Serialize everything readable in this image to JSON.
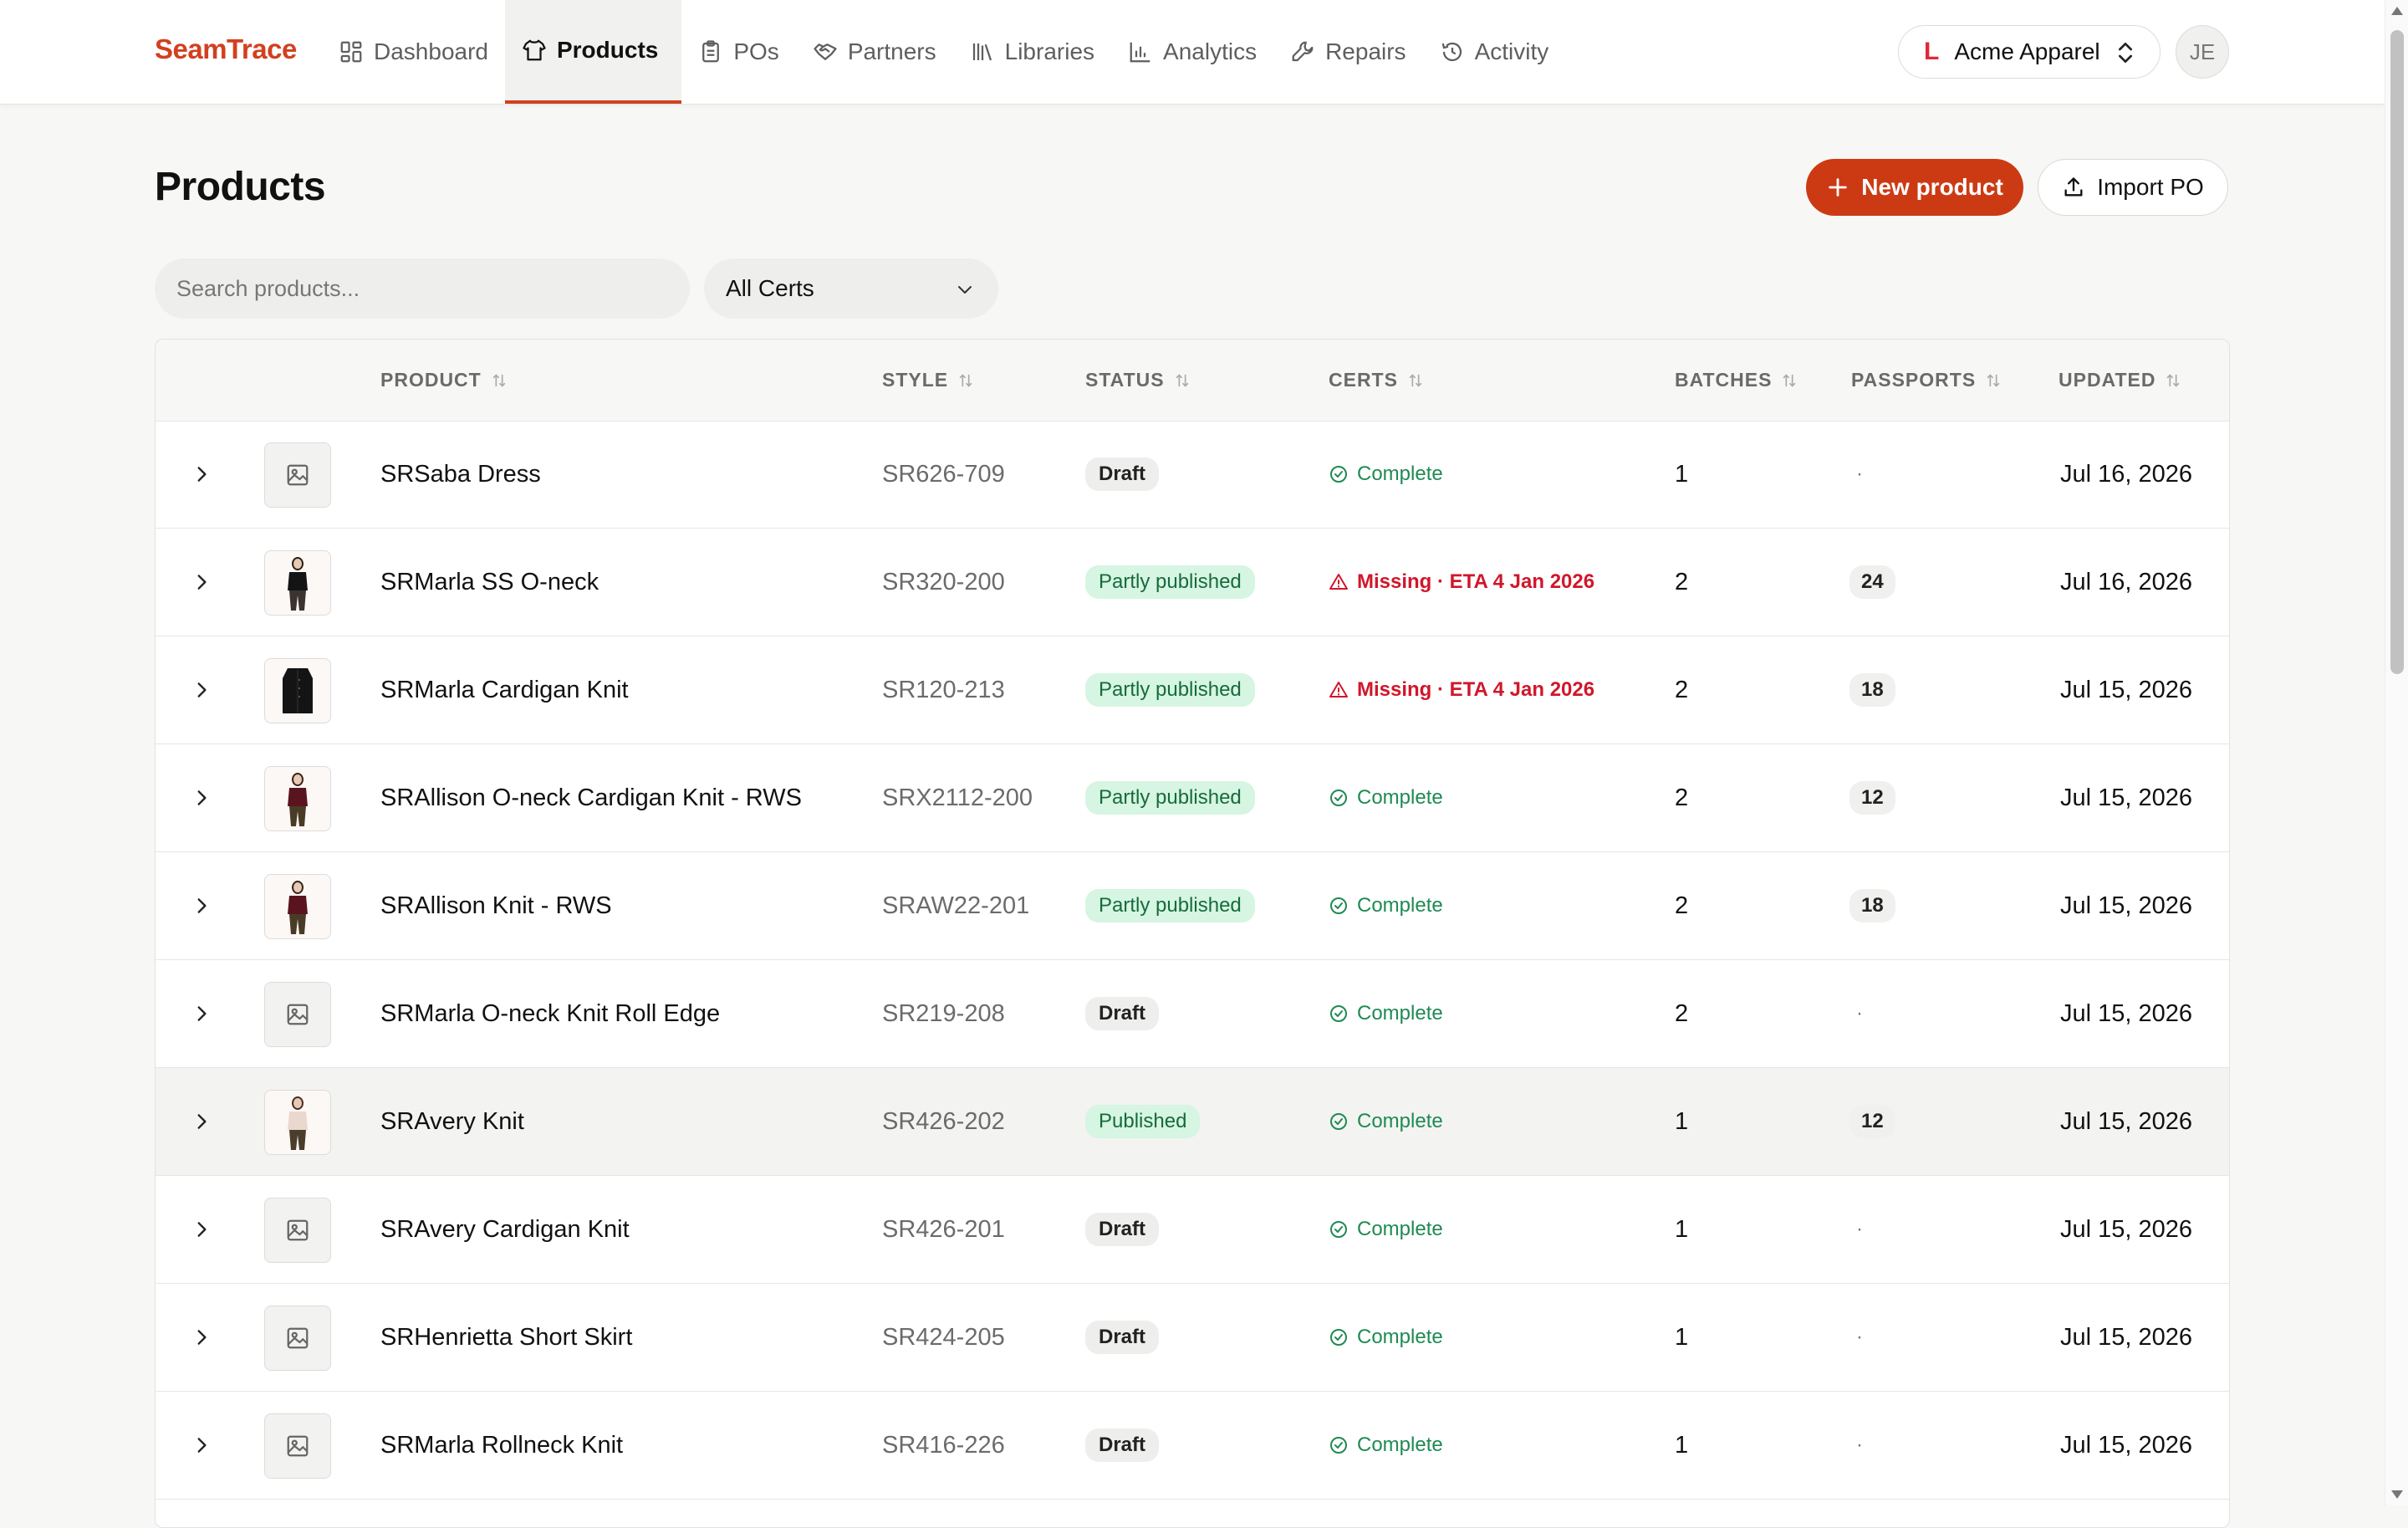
{
  "brand": "SeamTrace",
  "nav": [
    {
      "label": "Dashboard",
      "icon": "dashboard-icon"
    },
    {
      "label": "Products",
      "icon": "shirt-icon",
      "active": true
    },
    {
      "label": "POs",
      "icon": "clipboard-icon"
    },
    {
      "label": "Partners",
      "icon": "handshake-icon"
    },
    {
      "label": "Libraries",
      "icon": "library-icon"
    },
    {
      "label": "Analytics",
      "icon": "bar-chart-icon"
    },
    {
      "label": "Repairs",
      "icon": "wrench-icon"
    },
    {
      "label": "Activity",
      "icon": "history-icon"
    }
  ],
  "org": {
    "logo": "L",
    "name": "Acme Apparel"
  },
  "user": {
    "initials": "JE"
  },
  "page": {
    "title": "Products"
  },
  "actions": {
    "new_product": "New product",
    "import_po": "Import PO"
  },
  "filters": {
    "search_placeholder": "Search products...",
    "certs_value": "All Certs"
  },
  "table": {
    "columns": [
      "PRODUCT",
      "STYLE",
      "STATUS",
      "CERTS",
      "BATCHES",
      "PASSPORTS",
      "UPDATED"
    ],
    "rows": [
      {
        "name": "SRSaba Dress",
        "style": "SR626-709",
        "status": "Draft",
        "status_kind": "draft",
        "certs": "Complete",
        "certs_kind": "ok",
        "batches": "1",
        "passports": "·",
        "updated": "Jul 16, 2026",
        "thumb": "placeholder"
      },
      {
        "name": "SRMarla SS O-neck",
        "style": "SR320-200",
        "status": "Partly published",
        "status_kind": "partly",
        "certs": "Missing · ETA 4 Jan 2026",
        "certs_kind": "missing",
        "batches": "2",
        "passports": "24",
        "updated": "Jul 16, 2026",
        "thumb": "photo-black"
      },
      {
        "name": "SRMarla Cardigan Knit",
        "style": "SR120-213",
        "status": "Partly published",
        "status_kind": "partly",
        "certs": "Missing · ETA 4 Jan 2026",
        "certs_kind": "missing",
        "batches": "2",
        "passports": "18",
        "updated": "Jul 15, 2026",
        "thumb": "photo-cardigan"
      },
      {
        "name": "SRAllison O-neck Cardigan Knit - RWS",
        "style": "SRX2112-200",
        "status": "Partly published",
        "status_kind": "partly",
        "certs": "Complete",
        "certs_kind": "ok",
        "batches": "2",
        "passports": "12",
        "updated": "Jul 15, 2026",
        "thumb": "photo-burgundy"
      },
      {
        "name": "SRAllison Knit - RWS",
        "style": "SRAW22-201",
        "status": "Partly published",
        "status_kind": "partly",
        "certs": "Complete",
        "certs_kind": "ok",
        "batches": "2",
        "passports": "18",
        "updated": "Jul 15, 2026",
        "thumb": "photo-burgundy"
      },
      {
        "name": "SRMarla O-neck Knit Roll Edge",
        "style": "SR219-208",
        "status": "Draft",
        "status_kind": "draft",
        "certs": "Complete",
        "certs_kind": "ok",
        "batches": "2",
        "passports": "·",
        "updated": "Jul 15, 2026",
        "thumb": "placeholder"
      },
      {
        "name": "SRAvery Knit",
        "style": "SR426-202",
        "status": "Published",
        "status_kind": "pub",
        "certs": "Complete",
        "certs_kind": "ok",
        "batches": "1",
        "passports": "12",
        "updated": "Jul 15, 2026",
        "thumb": "photo-cream",
        "hover": true
      },
      {
        "name": "SRAvery Cardigan Knit",
        "style": "SR426-201",
        "status": "Draft",
        "status_kind": "draft",
        "certs": "Complete",
        "certs_kind": "ok",
        "batches": "1",
        "passports": "·",
        "updated": "Jul 15, 2026",
        "thumb": "placeholder"
      },
      {
        "name": "SRHenrietta Short Skirt",
        "style": "SR424-205",
        "status": "Draft",
        "status_kind": "draft",
        "certs": "Complete",
        "certs_kind": "ok",
        "batches": "1",
        "passports": "·",
        "updated": "Jul 15, 2026",
        "thumb": "placeholder"
      },
      {
        "name": "SRMarla Rollneck Knit",
        "style": "SR416-226",
        "status": "Draft",
        "status_kind": "draft",
        "certs": "Complete",
        "certs_kind": "ok",
        "batches": "1",
        "passports": "·",
        "updated": "Jul 15, 2026",
        "thumb": "placeholder"
      }
    ]
  },
  "colors": {
    "brand": "#d2401f",
    "primary_button": "#cc3a14",
    "ok": "#1f8a53",
    "missing": "#d0172a",
    "published_bg": "#d6f5e2"
  }
}
